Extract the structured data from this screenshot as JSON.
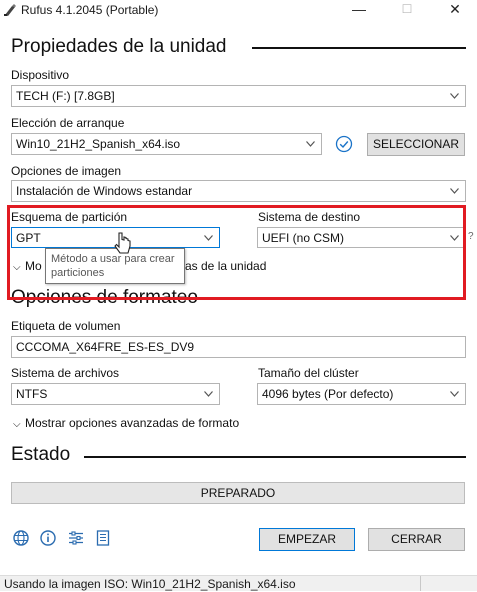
{
  "window": {
    "title": "Rufus 4.1.2045 (Portable)",
    "minimize_glyph": "—",
    "maximize_glyph": "☐",
    "close_glyph": "✕"
  },
  "drive_properties": {
    "header": "Propiedades de la unidad",
    "device_label": "Dispositivo",
    "device_value": "TECH (F:) [7.8GB]",
    "boot_selection_label": "Elección de arranque",
    "boot_selection_value": "Win10_21H2_Spanish_x64.iso",
    "select_button": "SELECCIONAR",
    "image_options_label": "Opciones de imagen",
    "image_options_value": "Instalación de Windows estandar",
    "partition_scheme_label": "Esquema de partición",
    "partition_scheme_value": "GPT",
    "target_system_label": "Sistema de destino",
    "target_system_value": "UEFI (no CSM)",
    "target_system_help": "?",
    "advanced_toggle_start": "Mo",
    "advanced_toggle_end": "as de la unidad"
  },
  "tooltip": {
    "text": "Método a usar para crear particiones"
  },
  "format_options": {
    "header": "Opciones de formateo",
    "volume_label_label": "Etiqueta de volumen",
    "volume_label_value": "CCCOMA_X64FRE_ES-ES_DV9",
    "file_system_label": "Sistema de archivos",
    "file_system_value": "NTFS",
    "cluster_size_label": "Tamaño del clúster",
    "cluster_size_value": "4096 bytes (Por defecto)",
    "advanced_toggle": "Mostrar opciones avanzadas de formato"
  },
  "status": {
    "header": "Estado",
    "progress_text": "PREPARADO",
    "progress_fraction": 0
  },
  "footer": {
    "start_button": "EMPEZAR",
    "close_button": "CERRAR",
    "status_bar": "Usando la imagen ISO: Win10_21H2_Spanish_x64.iso"
  },
  "colors": {
    "highlight": "#e11b22",
    "check_icon": "#1a73c8",
    "toolbar_icon": "#2b6cb0"
  }
}
